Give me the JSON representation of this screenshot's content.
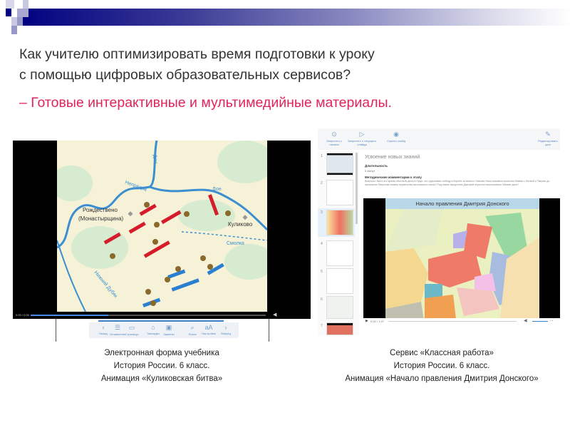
{
  "slide": {
    "title_line1": "Как учителю оптимизировать время подготовки к уроку",
    "title_line2": "с помощью цифровых образовательных сервисов?",
    "subtitle": "– Готовые интерактивные и мультимедийные материалы.",
    "accent_color": "#e0245a",
    "header_color": "#000080"
  },
  "left_shot": {
    "map_labels": {
      "don_top": "Дон",
      "nepryadva": "Непрядва",
      "don_right": "Дон",
      "rozhdestveno": "Рождествено",
      "monastyrshchina": "(Монастырщина)",
      "kulikovo": "Куликово",
      "smolka": "Смолка",
      "nizhny_dubyak": "Нижний Дубяк"
    },
    "toolbar": [
      "Назад",
      "Оглавление",
      "Страницы",
      "Закладки",
      "Заметки",
      "Поиск",
      "Настройки",
      "Вперёд"
    ],
    "time": "0:00 / 0:00",
    "progress": 0.33
  },
  "right_shot": {
    "toolbar": {
      "start": "Запустить с начала",
      "start_current": "Запустить с текущего слайда",
      "hide": "Скрыть слайд",
      "edit": "Редактировать урок"
    },
    "stage_title": "Усвоение новых знаний",
    "duration_label": "Длительность",
    "duration_value": "5 минут",
    "comments_label": "Методические комментарии к этапу",
    "comments_text": "Вопросы: Как в это время обстояли дела в Орде, кто одерживал победу в борьбе за власть? Каковы были взаимоотношения Мамая с Литвой и Тверью до признания Тверским князем первенства московского князя? Под каким предлогом Дмитрий перестал выплачивать Мамаю дань?",
    "video_title": "Начало правления Дмитрия Донского",
    "time": "0:00 / 1:47",
    "slide_numbers": [
      "1",
      "2",
      "3",
      "4",
      "5",
      "6",
      "7"
    ]
  },
  "captions": {
    "left": [
      "Электронная форма учебника",
      "История России. 6 класс.",
      "Анимация «Куликовская битва»"
    ],
    "right": [
      "Сервис «Классная работа»",
      "История России. 6 класс.",
      "Анимация «Начало правления Дмитрия Донского»"
    ]
  }
}
